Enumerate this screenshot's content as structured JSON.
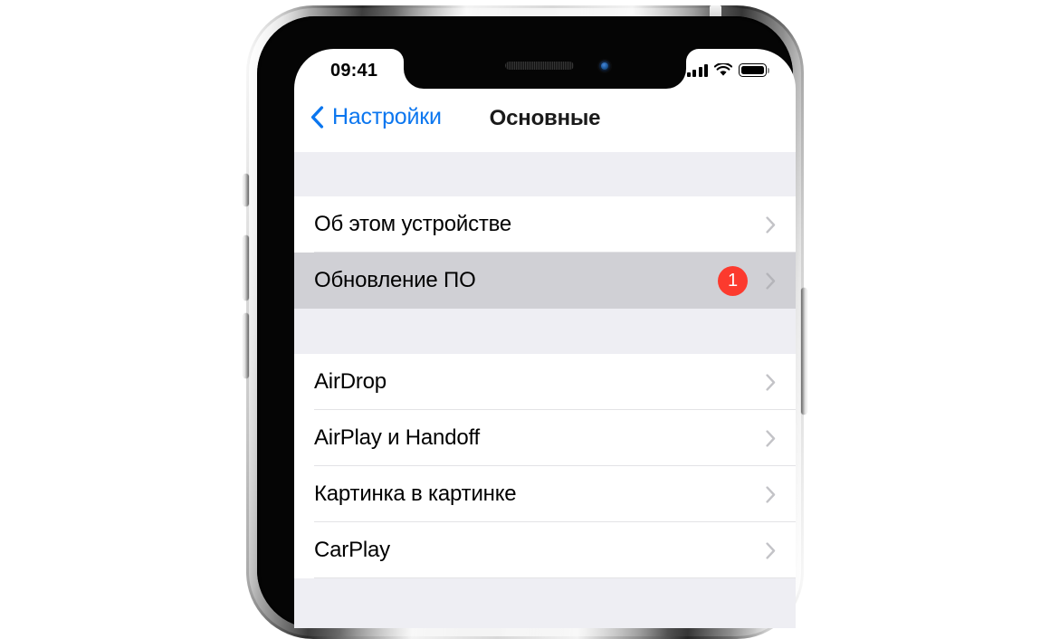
{
  "device": {
    "name": "iphone-x",
    "notch": {
      "speaker": "earpiece-speaker",
      "camera": "front-camera"
    },
    "buttons": [
      {
        "name": "mute-switch",
        "side": "left"
      },
      {
        "name": "volume-up-button",
        "side": "left"
      },
      {
        "name": "volume-down-button",
        "side": "left"
      },
      {
        "name": "side-power-button",
        "side": "right"
      }
    ]
  },
  "status_bar": {
    "time": "09:41",
    "cellular_icon": "signal-bars-icon",
    "cellular_bars": 4,
    "wifi_icon": "wifi-icon",
    "battery_icon": "battery-icon",
    "battery_full": true
  },
  "nav_bar": {
    "back_icon": "chevron-left-icon",
    "back_label": "Настройки",
    "title": "Основные"
  },
  "colors": {
    "accent_blue": "#0b76ef",
    "badge_red": "#fc3a2e",
    "row_selected": "#d0d0d5",
    "group_gap": "#eeeef3",
    "separator": "#e3e3e6",
    "chevron_gray": "#c3c3c7"
  },
  "list": {
    "groups": [
      {
        "name": "device-group",
        "rows": [
          {
            "label": "Об этом устройстве",
            "data_name": "row-about-device",
            "selected": false,
            "badge": null,
            "chevron_icon": "chevron-right-icon"
          },
          {
            "label": "Обновление ПО",
            "data_name": "row-software-update",
            "selected": true,
            "badge": "1",
            "chevron_icon": "chevron-right-icon"
          }
        ]
      },
      {
        "name": "connectivity-group",
        "rows": [
          {
            "label": "AirDrop",
            "data_name": "row-airdrop",
            "selected": false,
            "badge": null,
            "chevron_icon": "chevron-right-icon"
          },
          {
            "label": "AirPlay и Handoff",
            "data_name": "row-airplay-handoff",
            "selected": false,
            "badge": null,
            "chevron_icon": "chevron-right-icon"
          },
          {
            "label": "Картинка в картинке",
            "data_name": "row-picture-in-picture",
            "selected": false,
            "badge": null,
            "chevron_icon": "chevron-right-icon"
          },
          {
            "label": "CarPlay",
            "data_name": "row-carplay",
            "selected": false,
            "badge": null,
            "chevron_icon": "chevron-right-icon"
          }
        ]
      }
    ]
  }
}
